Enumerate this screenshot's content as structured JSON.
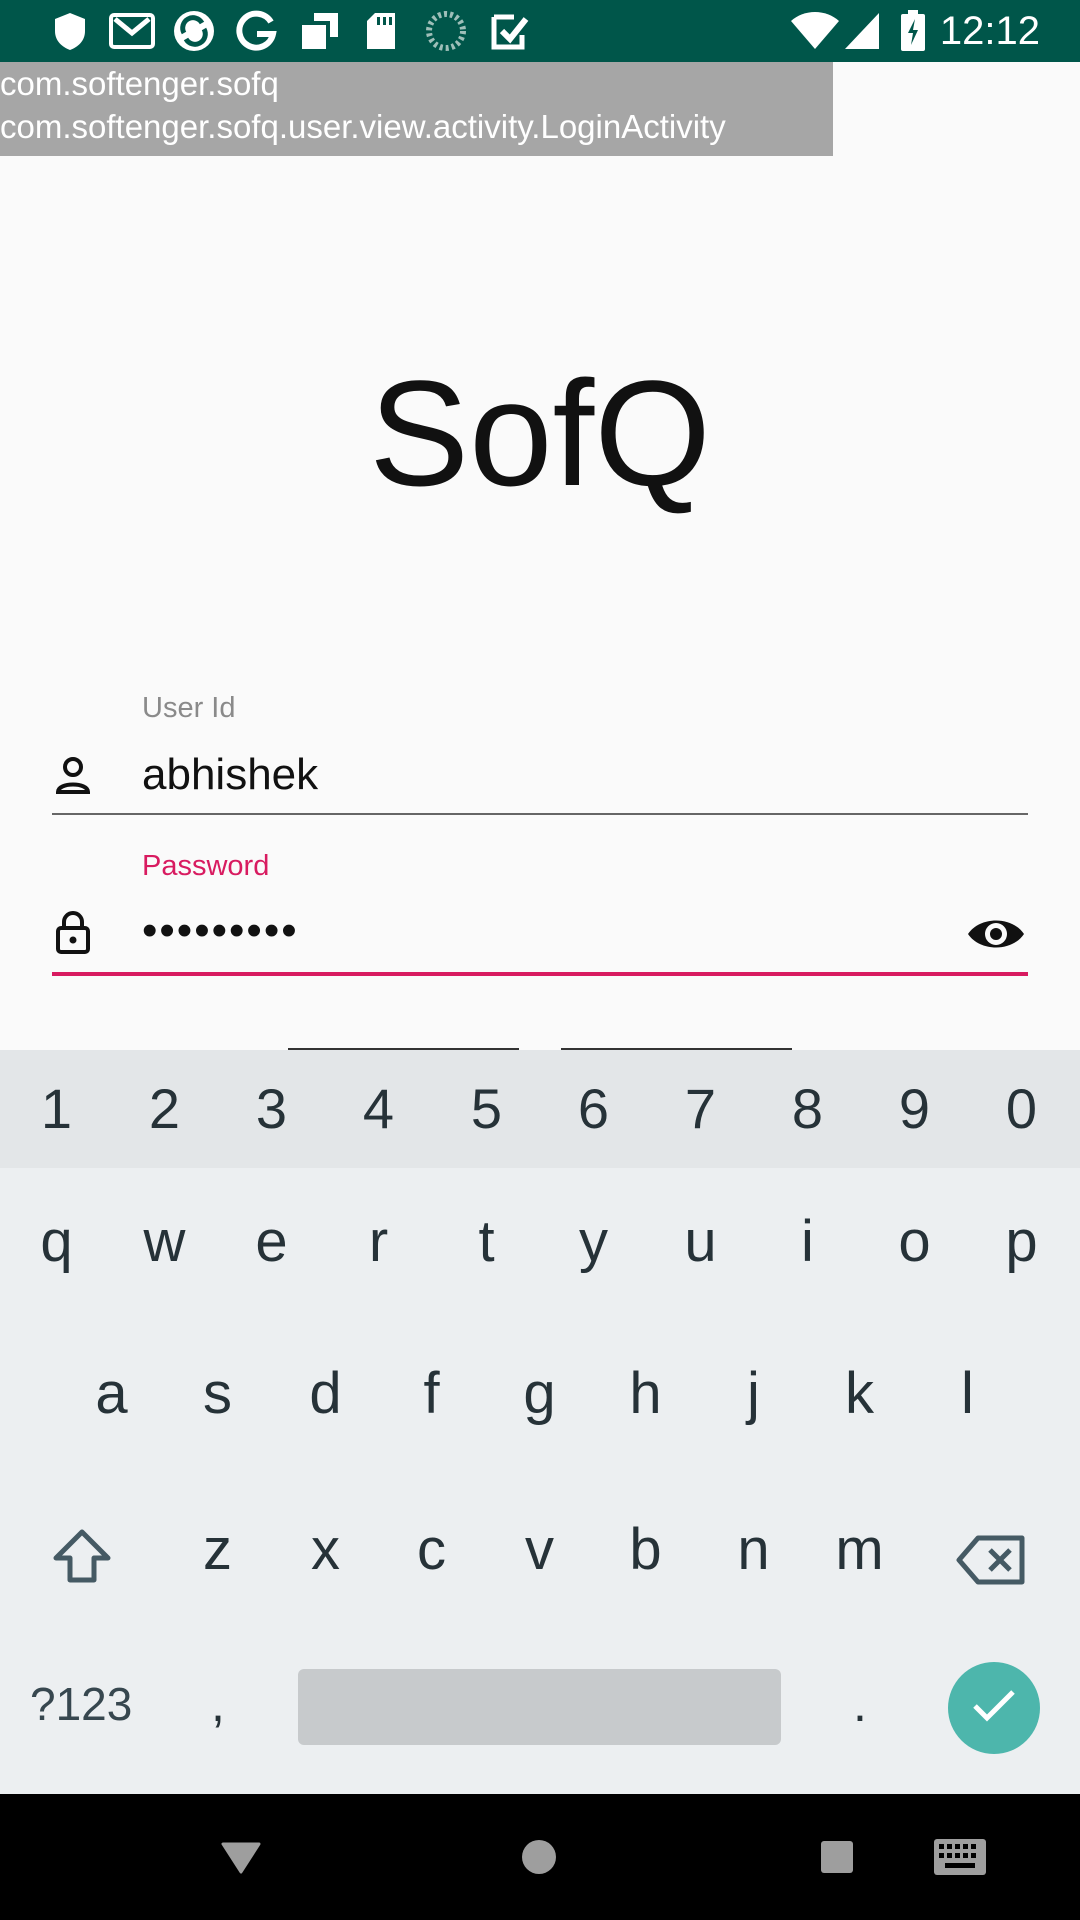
{
  "status_bar": {
    "time": "12:12",
    "left_icons": [
      "shield-icon",
      "gmail-icon",
      "sync-icon",
      "google-icon",
      "square-icon",
      "sd-card-icon",
      "progress-icon",
      "task-check-icon"
    ],
    "right_icons": [
      "wifi-icon",
      "signal-icon",
      "battery-charging-icon"
    ],
    "background": "#00564a"
  },
  "debug_overlay": {
    "package": "com.softenger.sofq",
    "activity": "com.softenger.sofq.user.view.activity.LoginActivity"
  },
  "app": {
    "title": "SofQ"
  },
  "form": {
    "user_id": {
      "label": "User Id",
      "value": "abhishek",
      "icon": "person-icon"
    },
    "password": {
      "label": "Password",
      "value": "•••••••••",
      "icon": "lock-icon",
      "toggle_icon": "eye-icon"
    },
    "accent_color": "#d81b60"
  },
  "keyboard": {
    "number_row": [
      "1",
      "2",
      "3",
      "4",
      "5",
      "6",
      "7",
      "8",
      "9",
      "0"
    ],
    "row1": [
      "q",
      "w",
      "e",
      "r",
      "t",
      "y",
      "u",
      "i",
      "o",
      "p"
    ],
    "row2": [
      "a",
      "s",
      "d",
      "f",
      "g",
      "h",
      "j",
      "k",
      "l"
    ],
    "row3": [
      "z",
      "x",
      "c",
      "v",
      "b",
      "n",
      "m"
    ],
    "symbols_label": "?123",
    "comma": ",",
    "period": ".",
    "enter_color": "#4db6ac"
  },
  "nav_bar": {
    "buttons": [
      "back-icon",
      "home-icon",
      "recents-icon",
      "keyboard-icon"
    ]
  }
}
